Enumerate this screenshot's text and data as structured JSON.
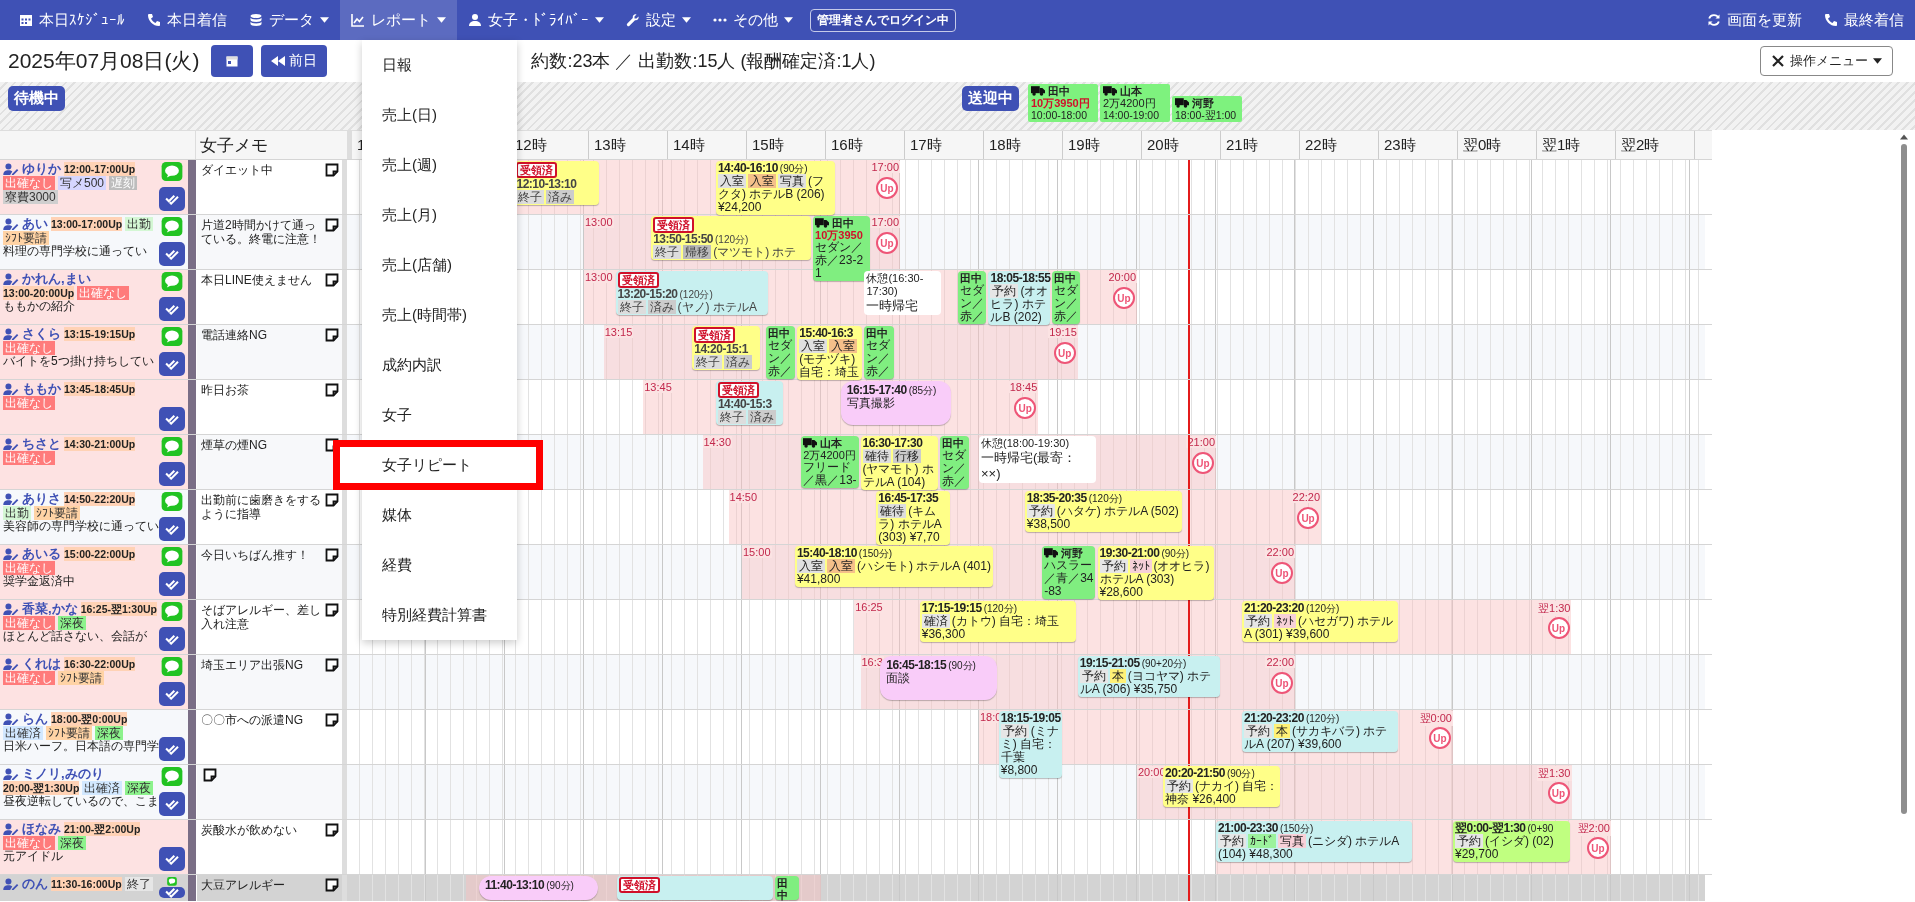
{
  "nav": {
    "items": [
      {
        "label": "本日ｽｹｼﾞｭｰﾙ",
        "dropdown": false,
        "selected": false
      },
      {
        "label": "本日着信",
        "dropdown": false,
        "selected": false
      },
      {
        "label": "データ",
        "dropdown": true,
        "selected": false
      },
      {
        "label": "レポート",
        "dropdown": true,
        "selected": true
      },
      {
        "label": "女子・ﾄﾞﾗｲﾊﾞｰ",
        "dropdown": true,
        "selected": false
      },
      {
        "label": "設定",
        "dropdown": true,
        "selected": false
      },
      {
        "label": "その他",
        "dropdown": true,
        "selected": false
      }
    ],
    "badge": "管理者さんでログイン中",
    "right": [
      {
        "label": "画面を更新"
      },
      {
        "label": "最終着信"
      }
    ]
  },
  "header": {
    "date": "2025年07月08日(火)",
    "prev_label": "前日",
    "stats": "約数:23本 ／ 出勤数:15人 (報酬確定済:1人)",
    "menu_button": "操作メニュー"
  },
  "status_bar": {
    "waiting": "待機中",
    "transit": "送迎中",
    "drivers": [
      {
        "name": "田中",
        "amount": "10万3950円",
        "amount_alert": true,
        "time": "10:00-18:00"
      },
      {
        "name": "山本",
        "amount": "2万4200円",
        "amount_alert": false,
        "time": "14:00-19:00"
      },
      {
        "name": "河野",
        "time": "18:00-翌1:00"
      }
    ]
  },
  "table": {
    "memo_heading": "女子メモ",
    "hours": [
      "1",
      "12時",
      "13時",
      "14時",
      "15時",
      "16時",
      "17時",
      "18時",
      "19時",
      "20時",
      "21時",
      "22時",
      "23時",
      "翌0時",
      "翌1時",
      "翌2時"
    ],
    "rows": [
      {
        "name": "ゆりか",
        "time": "12:00-17:00Up",
        "highlighted": true,
        "ended": false,
        "line": true,
        "tags": [
          {
            "text": "出確なし",
            "color": "#ff7b7b"
          },
          {
            "text": "写メ500",
            "color": "#d6d6ff"
          },
          {
            "text": "遅刻",
            "color": "#bdbdbd"
          },
          {
            "text": "寮費3000",
            "color": "#cfcfcf"
          }
        ],
        "memo": "ダイエット中",
        "shift": {
          "end": "17:00",
          "up": "Up"
        },
        "blocks": [
          {
            "kind": "job",
            "color": "#ffff88",
            "stamp": "受領済",
            "time": "12:10-13:10",
            "tags": [
              {
                "text": "終子",
                "color": "#dddddd"
              },
              {
                "text": "済み",
                "color": "#cccccc"
              }
            ]
          },
          {
            "kind": "job",
            "color": "#ffff88",
            "time": "14:40-16:10",
            "duration": "(90分)",
            "tags": [
              {
                "text": "入室",
                "color": "#e0e0e0"
              },
              {
                "text": "入室",
                "color": "#f5c08a"
              },
              {
                "text": "写真",
                "color": "#e0e0e0"
              }
            ],
            "detail": "(フクタ) ホテルB (206) ¥24,200"
          }
        ]
      },
      {
        "name": "あい",
        "time": "13:00-17:00Up",
        "highlighted": false,
        "ended": false,
        "line": true,
        "tags": [
          {
            "text": "出勤",
            "color": "#d4f7d4"
          },
          {
            "text": "ｼﾌﾄ要請",
            "color": "#ffd3a5"
          }
        ],
        "note": "料理の専門学校に通ってい",
        "memo": "片道2時間かけて通っている。終電に注意！",
        "shift": {
          "start": "13:00",
          "end": "17:00",
          "up": "Up"
        },
        "blocks": [
          {
            "kind": "job",
            "color": "#ffff88",
            "stamp": "受領済",
            "time": "13:50-15:50",
            "duration": "(120分)",
            "tags": [
              {
                "text": "終子",
                "color": "#dddddd"
              },
              {
                "text": "帰移",
                "color": "#bbbbbb"
              }
            ],
            "detail": "(マツモト) ホテ"
          },
          {
            "kind": "driver",
            "name": "田中",
            "amount": "10万3950",
            "amount_alert": true,
            "car": "セダン／赤／23-21"
          }
        ]
      },
      {
        "name": "かれん,まい",
        "time": "13:00-20:00Up",
        "highlighted": true,
        "ended": false,
        "line": true,
        "tags": [
          {
            "text": "出確なし",
            "color": "#ff7b7b"
          }
        ],
        "note": "ももかの紹介",
        "memo": "本日LINE使えません",
        "shift": {
          "start": "13:00",
          "end": "20:00",
          "up": "Up"
        },
        "blocks": [
          {
            "kind": "job",
            "color": "#c8f0f0",
            "stamp": "受領済",
            "time": "13:20-15:20",
            "duration": "(120分)",
            "tags": [
              {
                "text": "終子",
                "color": "#dddddd"
              },
              {
                "text": "済み",
                "color": "#cccccc"
              }
            ],
            "detail": "(ヤノ) ホテルA"
          },
          {
            "kind": "break",
            "title": "休憩(16:30-17:30)",
            "note": "一時帰宅"
          },
          {
            "kind": "driver",
            "name": "田中",
            "car": "セダン／赤／"
          },
          {
            "kind": "job",
            "color": "#c8f0f0",
            "time": "18:05-18:55",
            "tags": [
              {
                "text": "予約",
                "color": "#e6e6e6"
              }
            ],
            "detail": "(オオヒラ) ホテルB (202)"
          },
          {
            "kind": "driver",
            "name": "田中",
            "car": "セダン／赤／"
          }
        ]
      },
      {
        "name": "さくら",
        "time": "13:15-19:15Up",
        "highlighted": true,
        "ended": false,
        "line": true,
        "tags": [
          {
            "text": "出確なし",
            "color": "#ff7b7b"
          }
        ],
        "note": "バイトを5つ掛け持ちしてい",
        "memo": "電話連絡NG",
        "shift": {
          "start": "13:15",
          "end": "19:15",
          "up": "Up"
        },
        "blocks": [
          {
            "kind": "job",
            "color": "#ffff88",
            "stamp": "受領済",
            "time": "14:20-15:1",
            "tags": [
              {
                "text": "終子",
                "color": "#dddddd"
              },
              {
                "text": "済み",
                "color": "#cccccc"
              }
            ]
          },
          {
            "kind": "driver",
            "name": "田中",
            "car": "セダン／赤／"
          },
          {
            "kind": "job",
            "color": "#ffff88",
            "time": "15:40-16:3",
            "tags": [
              {
                "text": "入室",
                "color": "#e0e0e0"
              },
              {
                "text": "入室",
                "color": "#f5c08a"
              }
            ],
            "detail": "(モチヅキ) 自宅：埼玉"
          },
          {
            "kind": "driver",
            "name": "田中",
            "car": "セダン／赤／"
          }
        ]
      },
      {
        "name": "ももか",
        "time": "13:45-18:45Up",
        "highlighted": true,
        "ended": false,
        "line": false,
        "tags": [
          {
            "text": "出確なし",
            "color": "#ff7b7b"
          }
        ],
        "memo": "昨日お茶",
        "shift": {
          "start": "13:45",
          "end": "18:45",
          "up": "Up"
        },
        "blocks": [
          {
            "kind": "job",
            "color": "#c8f0f0",
            "stamp": "受領済",
            "time": "14:40-15:3",
            "tags": [
              {
                "text": "終子",
                "color": "#dddddd"
              },
              {
                "text": "済み",
                "color": "#cccccc"
              }
            ]
          },
          {
            "kind": "event",
            "time": "16:15-17:40",
            "duration": "(85分)",
            "detail": "写真撮影"
          }
        ]
      },
      {
        "name": "ちさと",
        "time": "14:30-21:00Up",
        "highlighted": true,
        "ended": false,
        "line": true,
        "tags": [
          {
            "text": "出確なし",
            "color": "#ff7b7b"
          }
        ],
        "memo": "煙草の煙NG",
        "shift": {
          "start": "14:30",
          "end": "21:00",
          "up": "Up"
        },
        "blocks": [
          {
            "kind": "driver",
            "name": "山本",
            "amount": "2万4200円",
            "amount_alert": false,
            "car": "フリード／黒／13-"
          },
          {
            "kind": "job",
            "color": "#ffff88",
            "time": "16:30-17:30",
            "tags": [
              {
                "text": "確待",
                "color": "#dddddd"
              },
              {
                "text": "行移",
                "color": "#cccccc"
              }
            ],
            "detail": "(ヤマモト) ホテルA (104)"
          },
          {
            "kind": "driver",
            "name": "田中",
            "car": "セダン／赤／"
          },
          {
            "kind": "break",
            "title": "休憩(18:00-19:30)",
            "note": "一時帰宅(最寄：××)"
          }
        ]
      },
      {
        "name": "ありさ",
        "time": "14:50-22:20Up",
        "highlighted": false,
        "ended": false,
        "line": true,
        "tags": [
          {
            "text": "出勤",
            "color": "#d4f7d4"
          },
          {
            "text": "ｼﾌﾄ要請",
            "color": "#ffd3a5"
          }
        ],
        "note": "美容師の専門学校に通ってい",
        "memo": "出勤前に歯磨きをするように指導",
        "shift": {
          "start": "14:50",
          "end": "22:20",
          "up": "Up"
        },
        "blocks": [
          {
            "kind": "job",
            "color": "#ffff88",
            "time": "16:45-17:35",
            "tags": [
              {
                "text": "確待",
                "color": "#dddddd"
              }
            ],
            "detail": "(キムラ) ホテルA (303) ¥7,70"
          },
          {
            "kind": "job",
            "color": "#ffff88",
            "time": "18:35-20:35",
            "duration": "(120分)",
            "tags": [
              {
                "text": "予約",
                "color": "#e6e6e6"
              }
            ],
            "detail": "(ハタケ) ホテルA (502) ¥38,500"
          }
        ]
      },
      {
        "name": "あいる",
        "time": "15:00-22:00Up",
        "highlighted": true,
        "ended": false,
        "line": true,
        "tags": [
          {
            "text": "出確なし",
            "color": "#ff7b7b"
          }
        ],
        "note": "奨学金返済中",
        "memo": "今日いちばん推す！",
        "shift": {
          "start": "15:00",
          "end": "22:00",
          "up": "Up"
        },
        "blocks": [
          {
            "kind": "job",
            "color": "#ffff88",
            "time": "15:40-18:10",
            "duration": "(150分)",
            "tags": [
              {
                "text": "入室",
                "color": "#e0e0e0"
              },
              {
                "text": "入室",
                "color": "#f5c08a"
              }
            ],
            "detail": "(ハシモト) ホテルA (401) ¥41,800"
          },
          {
            "kind": "driver",
            "name": "河野",
            "car": "ハスラー／青／34-83"
          },
          {
            "kind": "job",
            "color": "#ffff88",
            "time": "19:30-21:00",
            "duration": "(90分)",
            "tags": [
              {
                "text": "予約",
                "color": "#e6e6e6"
              },
              {
                "text": "ﾈｯﾄ",
                "color": "#f6d0d8"
              }
            ],
            "detail": "(オオヒラ) ホテルA (303) ¥28,600"
          }
        ]
      },
      {
        "name": "香菜,かな",
        "time": "16:25-翌1:30Up",
        "highlighted": true,
        "ended": false,
        "line": true,
        "tags": [
          {
            "text": "出確なし",
            "color": "#ff7b7b"
          },
          {
            "text": "深夜",
            "color": "#8cf28c"
          }
        ],
        "note": "ほとんど話さない、会話が",
        "memo": "そばアレルギー、差し入れ注意",
        "shift": {
          "start": "16:25",
          "end": "翌1:30",
          "up": "Up"
        },
        "blocks": [
          {
            "kind": "job",
            "color": "#ffff88",
            "time": "17:15-19:15",
            "duration": "(120分)",
            "tags": [
              {
                "text": "確済",
                "color": "#e6e6e6"
              }
            ],
            "detail": "(カトウ) 自宅：埼玉 ¥36,300"
          },
          {
            "kind": "job",
            "color": "#ffff88",
            "time": "21:20-23:20",
            "duration": "(120分)",
            "tags": [
              {
                "text": "予約",
                "color": "#e6e6e6"
              },
              {
                "text": "ﾈｯﾄ",
                "color": "#f6d0d8"
              }
            ],
            "detail": "(ハセガワ) ホテルA (301) ¥39,600"
          }
        ]
      },
      {
        "name": "くれは",
        "time": "16:30-22:00Up",
        "highlighted": true,
        "ended": false,
        "line": true,
        "tags": [
          {
            "text": "出確なし",
            "color": "#ff7b7b"
          },
          {
            "text": "ｼﾌﾄ要請",
            "color": "#ffd3a5"
          }
        ],
        "memo": "埼玉エリア出張NG",
        "shift": {
          "start": "16:3",
          "end": "22:00",
          "up": "Up"
        },
        "blocks": [
          {
            "kind": "event",
            "time": "16:45-18:15",
            "duration": "(90分)",
            "detail": "面談"
          },
          {
            "kind": "job",
            "color": "#c8f0f0",
            "time": "19:15-21:05",
            "duration": "(90+20分)",
            "tags": [
              {
                "text": "予約",
                "color": "#e6e6e6"
              },
              {
                "text": "本",
                "color": "#fff176"
              }
            ],
            "detail": "(ヨコヤマ) ホテルA (306) ¥35,750"
          }
        ]
      },
      {
        "name": "らん",
        "time": "18:00-翌0:00Up",
        "highlighted": false,
        "ended": false,
        "line": false,
        "tags": [
          {
            "text": "出確済",
            "color": "#d2e8ff"
          },
          {
            "text": "ｼﾌﾄ要請",
            "color": "#ffd3a5"
          },
          {
            "text": "深夜",
            "color": "#8cf28c"
          }
        ],
        "note": "日米ハーフ。日本語の専門学",
        "memo": "〇〇市への派遣NG",
        "shift": {
          "start": "18:0",
          "end": "翌0:00",
          "up": "Up"
        },
        "blocks": [
          {
            "kind": "job",
            "color": "#c8f0f0",
            "time": "18:15-19:05",
            "tags": [
              {
                "text": "予約",
                "color": "#e6e6e6"
              }
            ],
            "detail": "(ミナミ) 自宅：千葉 ¥8,800"
          },
          {
            "kind": "job",
            "color": "#c8f0f0",
            "time": "21:20-23:20",
            "duration": "(120分)",
            "tags": [
              {
                "text": "予約",
                "color": "#e6e6e6"
              },
              {
                "text": "本",
                "color": "#fff176"
              }
            ],
            "detail": "(サカキバラ) ホテルA (207) ¥39,600"
          }
        ]
      },
      {
        "name": "ミノリ,みのり",
        "time": "20:00-翌1:30Up",
        "highlighted": false,
        "ended": false,
        "line": true,
        "tags": [
          {
            "text": "出確済",
            "color": "#d2e8ff"
          },
          {
            "text": "深夜",
            "color": "#8cf28c"
          }
        ],
        "note": "昼夜逆転しているので、こま",
        "shift": {
          "start": "20:00",
          "end": "翌1:30",
          "up": "Up"
        },
        "blocks": [
          {
            "kind": "job",
            "color": "#ffff88",
            "time": "20:20-21:50",
            "duration": "(90分)",
            "tags": [
              {
                "text": "予約",
                "color": "#e6e6e6"
              }
            ],
            "detail": "(ナカイ) 自宅：神奈 ¥26,400"
          }
        ]
      },
      {
        "name": "ほなみ",
        "time": "21:00-翌2:00Up",
        "highlighted": true,
        "ended": false,
        "line": false,
        "tags": [
          {
            "text": "出確なし",
            "color": "#ff7b7b"
          },
          {
            "text": "深夜",
            "color": "#8cf28c"
          }
        ],
        "note": "元アイドル",
        "memo": "炭酸水が飲めない",
        "shift": {
          "end": "翌2:00",
          "up": "Up"
        },
        "blocks": [
          {
            "kind": "job",
            "color": "#c8f0f0",
            "time": "21:00-23:30",
            "duration": "(150分)",
            "tags": [
              {
                "text": "予約",
                "color": "#e6e6e6"
              },
              {
                "text": "ｶｰﾄﾞ",
                "color": "#9cf29c"
              },
              {
                "text": "写真",
                "color": "#f8d0d8"
              }
            ],
            "detail": "(ニシダ) ホテルA (104) ¥48,300"
          },
          {
            "kind": "job",
            "color": "#c0ff80",
            "time": "翌0:00-翌1:30",
            "duration": "(0+90",
            "tags": [
              {
                "text": "予約",
                "color": "#e6e6e6"
              }
            ],
            "detail": "(イシダ) (02) ¥29,700"
          }
        ]
      },
      {
        "name": "のん",
        "time": "11:30-16:00Up",
        "ended": true,
        "line": true,
        "tags": [
          {
            "text": "終了",
            "color": "#e6e6e6"
          }
        ],
        "memo": "大豆アレルギー",
        "shift": {},
        "blocks": [
          {
            "kind": "event",
            "time": "11:40-13:10",
            "duration": "(90分)"
          },
          {
            "kind": "job",
            "color": "#c8f0f0",
            "stamp": "受領済"
          },
          {
            "kind": "driver",
            "name": "田中"
          }
        ]
      }
    ]
  },
  "report_menu": {
    "items": [
      {
        "label": "日報",
        "selected": false
      },
      {
        "label": "売上(日)",
        "selected": false
      },
      {
        "label": "売上(週)",
        "selected": false
      },
      {
        "label": "売上(月)",
        "selected": false
      },
      {
        "label": "売上(店舗)",
        "selected": false
      },
      {
        "label": "売上(時間帯)",
        "selected": false
      },
      {
        "label": "成約内訳",
        "selected": false
      },
      {
        "label": "女子",
        "selected": false
      },
      {
        "label": "女子リピート",
        "selected": true
      },
      {
        "label": "媒体",
        "selected": false
      },
      {
        "label": "経費",
        "selected": false
      },
      {
        "label": "特別経費計算書",
        "selected": false
      }
    ]
  }
}
